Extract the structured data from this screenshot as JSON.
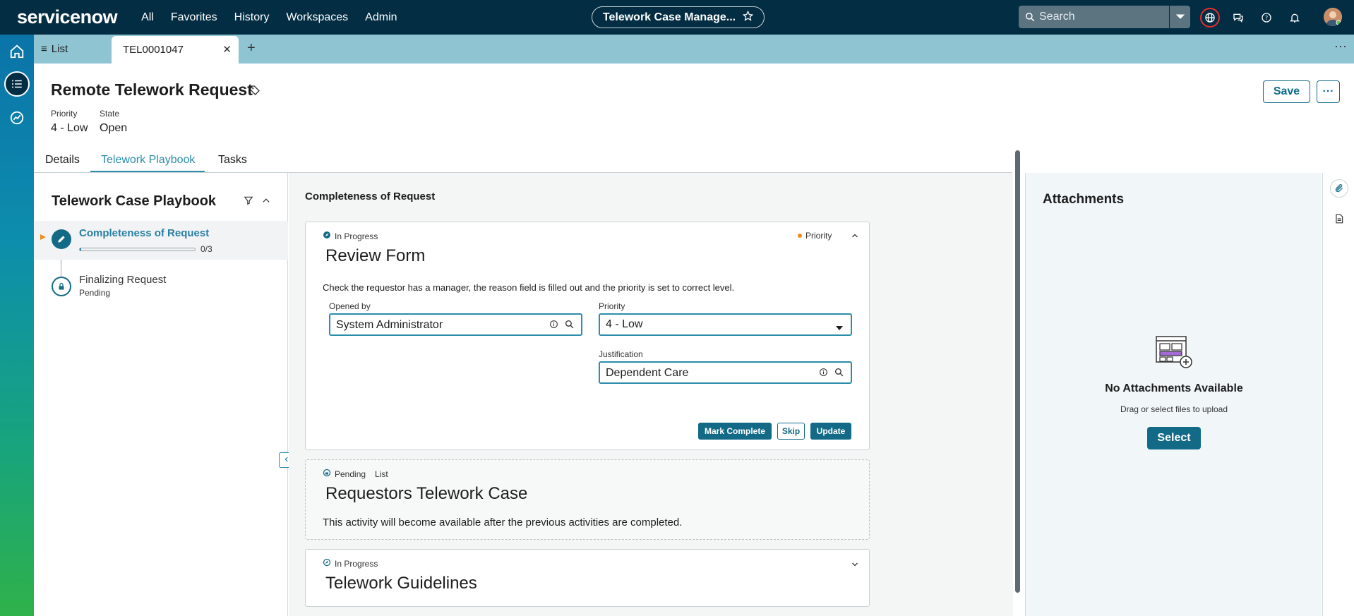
{
  "brand": {
    "name": "servicenow"
  },
  "topnav": {
    "items": [
      "All",
      "Favorites",
      "History",
      "Workspaces",
      "Admin"
    ]
  },
  "context": {
    "title": "Telework Case Manage..."
  },
  "search": {
    "placeholder": "Search"
  },
  "tabs": {
    "list_label": "List",
    "record_label": "TEL0001047"
  },
  "record": {
    "title": "Remote Telework Request",
    "priority_label": "Priority",
    "priority_value": "4 - Low",
    "state_label": "State",
    "state_value": "Open",
    "save_label": "Save",
    "more_label": "···"
  },
  "record_tabs": [
    "Details",
    "Telework Playbook",
    "Tasks"
  ],
  "playbook": {
    "title": "Telework Case Playbook",
    "steps": [
      {
        "name": "Completeness of Request",
        "progress_text": "0/3",
        "progress": 0.0
      },
      {
        "name": "Finalizing Request",
        "status": "Pending"
      }
    ]
  },
  "activities": {
    "section_title": "Completeness of Request",
    "review": {
      "status": "In Progress",
      "priority_tag": "Priority",
      "title": "Review Form",
      "instructions": "Check the requestor has a manager, the reason field is filled out and the priority is set to correct level.",
      "opened_by_label": "Opened by",
      "opened_by_value": "System Administrator",
      "priority_label": "Priority",
      "priority_value": "4 - Low",
      "justification_label": "Justification",
      "justification_value": "Dependent Care",
      "mark_complete_label": "Mark Complete",
      "skip_label": "Skip",
      "update_label": "Update"
    },
    "requestors": {
      "status": "Pending",
      "type": "List",
      "title": "Requestors Telework Case",
      "message": "This activity will become available after the previous activities are completed."
    },
    "guidelines": {
      "status": "In Progress",
      "title": "Telework Guidelines"
    }
  },
  "attachments": {
    "title": "Attachments",
    "empty_title": "No Attachments Available",
    "empty_hint": "Drag or select files to upload",
    "select_label": "Select"
  },
  "colors": {
    "accent": "#136a87",
    "topbar": "#032d42",
    "tabbar": "#8fc4d3",
    "priority_dot": "#f28b1e"
  }
}
